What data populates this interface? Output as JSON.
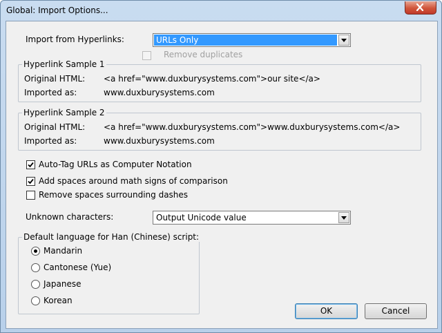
{
  "window": {
    "title": "Global: Import Options..."
  },
  "hyperlinks": {
    "label": "Import from Hyperlinks:",
    "value": "URLs Only",
    "remove_duplicates": {
      "label": "Remove duplicates",
      "checked": false,
      "enabled": false
    }
  },
  "sample1": {
    "title": "Hyperlink Sample 1",
    "original_label": "Original HTML:",
    "original_value": "<a href=\"www.duxburysystems.com\">our site</a>",
    "imported_label": "Imported as:",
    "imported_value": "www.duxburysystems.com"
  },
  "sample2": {
    "title": "Hyperlink Sample 2",
    "original_label": "Original HTML:",
    "original_value": "<a href=\"www.duxburysystems.com\">www.duxburysystems.com</a>",
    "imported_label": "Imported as:",
    "imported_value": "www.duxburysystems.com"
  },
  "options": [
    {
      "label": "Auto-Tag URLs as Computer Notation",
      "checked": true
    },
    {
      "label": "Add spaces around math signs of comparison",
      "checked": true
    },
    {
      "label": "Remove spaces surrounding dashes",
      "checked": false
    }
  ],
  "unknown": {
    "label": "Unknown characters:",
    "value": "Output Unicode value"
  },
  "language": {
    "title": "Default language for Han (Chinese) script:",
    "options": [
      {
        "label": "Mandarin",
        "selected": true
      },
      {
        "label": "Cantonese (Yue)",
        "selected": false
      },
      {
        "label": "Japanese",
        "selected": false
      },
      {
        "label": "Korean",
        "selected": false
      }
    ]
  },
  "buttons": {
    "ok": "OK",
    "cancel": "Cancel"
  }
}
